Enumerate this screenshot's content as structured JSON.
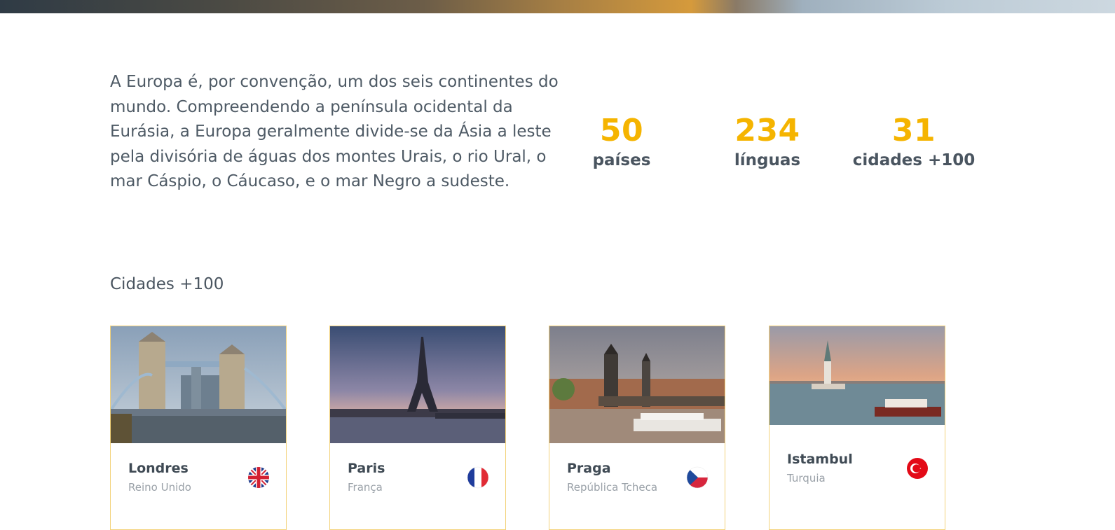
{
  "intro": {
    "text": "A Europa é, por convenção, um dos seis continentes do mundo. Compreendendo a península ocidental da Eurásia, a Europa geralmente divide-se da Ásia a leste pela divisória de águas dos montes Urais, o rio Ural, o mar Cáspio, o Cáucaso, e o mar Negro a sudeste."
  },
  "stats": [
    {
      "value": "50",
      "label": "países"
    },
    {
      "value": "234",
      "label": "línguas"
    },
    {
      "value": "31",
      "label": "cidades +100"
    }
  ],
  "cities_section": {
    "title": "Cidades +100"
  },
  "cities": [
    {
      "name": "Londres",
      "country": "Reino Unido",
      "flag_icon": "uk-flag-icon"
    },
    {
      "name": "Paris",
      "country": "França",
      "flag_icon": "france-flag-icon"
    },
    {
      "name": "Praga",
      "country": "República Tcheca",
      "flag_icon": "czech-flag-icon"
    },
    {
      "name": "Istambul",
      "country": "Turquia",
      "flag_icon": "turkey-flag-icon"
    }
  ],
  "colors": {
    "accent": "#f5b400",
    "text": "#4a5560",
    "muted": "#9aa1a8",
    "card_border": "#f3d27a"
  }
}
